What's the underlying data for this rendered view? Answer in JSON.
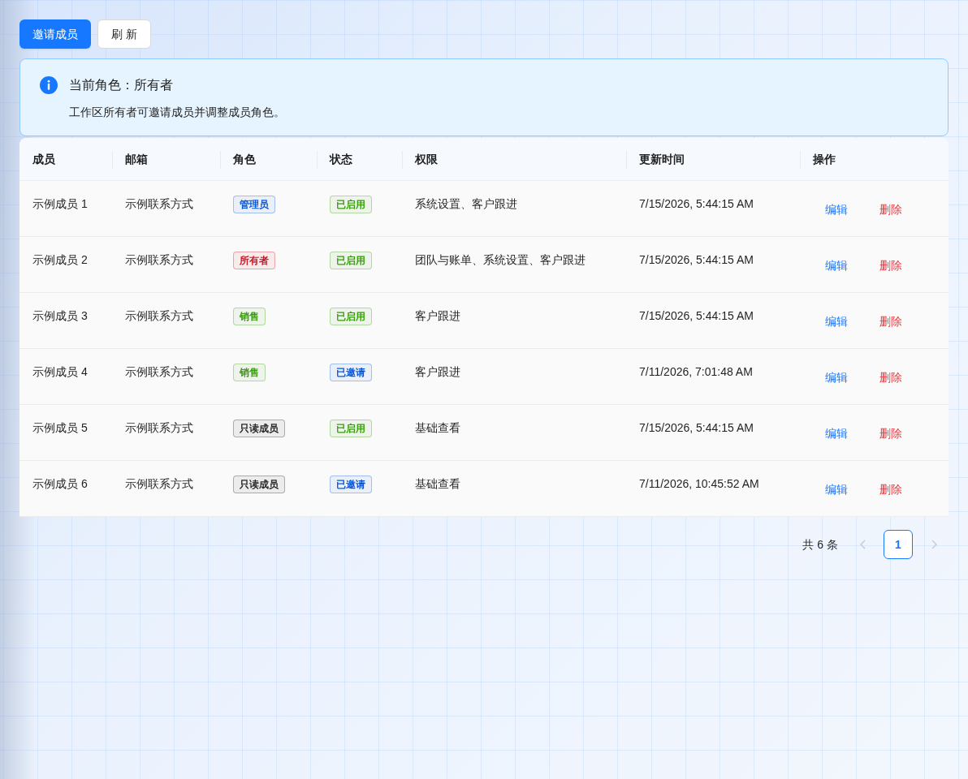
{
  "toolbar": {
    "buttons": [
      {
        "label": "邀请成员",
        "kind": "primary"
      },
      {
        "label": "刷 新",
        "kind": "default"
      }
    ]
  },
  "alert": {
    "title": "当前角色：所有者",
    "description": "工作区所有者可邀请成员并调整成员角色。"
  },
  "table": {
    "columns": [
      "成员",
      "邮箱",
      "角色",
      "状态",
      "权限",
      "更新时间",
      "操作"
    ],
    "rows": [
      {
        "member": "示例成员 1",
        "email": "示例联系方式",
        "role": {
          "label": "管理员",
          "color": "#0958d9"
        },
        "status": {
          "label": "已启用",
          "color": "#389e0d"
        },
        "permissions": "系统设置、客户跟进",
        "updated": "7/15/2026, 5:44:15 AM",
        "actions": [
          {
            "label": "编辑",
            "kind": "edit"
          },
          {
            "label": "删除",
            "kind": "delete"
          }
        ]
      },
      {
        "member": "示例成员 2",
        "email": "示例联系方式",
        "role": {
          "label": "所有者",
          "color": "#cf1322"
        },
        "status": {
          "label": "已启用",
          "color": "#389e0d"
        },
        "permissions": "团队与账单、系统设置、客户跟进",
        "updated": "7/15/2026, 5:44:15 AM",
        "actions": [
          {
            "label": "编辑",
            "kind": "edit"
          },
          {
            "label": "删除",
            "kind": "delete"
          }
        ]
      },
      {
        "member": "示例成员 3",
        "email": "示例联系方式",
        "role": {
          "label": "销售",
          "color": "#389e0d"
        },
        "status": {
          "label": "已启用",
          "color": "#389e0d"
        },
        "permissions": "客户跟进",
        "updated": "7/15/2026, 5:44:15 AM",
        "actions": [
          {
            "label": "编辑",
            "kind": "edit"
          },
          {
            "label": "删除",
            "kind": "delete"
          }
        ]
      },
      {
        "member": "示例成员 4",
        "email": "示例联系方式",
        "role": {
          "label": "销售",
          "color": "#389e0d"
        },
        "status": {
          "label": "已邀请",
          "color": "#0958d9"
        },
        "permissions": "客户跟进",
        "updated": "7/11/2026, 7:01:48 AM",
        "actions": [
          {
            "label": "编辑",
            "kind": "edit"
          },
          {
            "label": "删除",
            "kind": "delete"
          }
        ]
      },
      {
        "member": "示例成员 5",
        "email": "示例联系方式",
        "role": {
          "label": "只读成员",
          "color": "#262626"
        },
        "status": {
          "label": "已启用",
          "color": "#389e0d"
        },
        "permissions": "基础查看",
        "updated": "7/15/2026, 5:44:15 AM",
        "actions": [
          {
            "label": "编辑",
            "kind": "edit"
          },
          {
            "label": "删除",
            "kind": "delete"
          }
        ]
      },
      {
        "member": "示例成员 6",
        "email": "示例联系方式",
        "role": {
          "label": "只读成员",
          "color": "#262626"
        },
        "status": {
          "label": "已邀请",
          "color": "#0958d9"
        },
        "permissions": "基础查看",
        "updated": "7/11/2026, 10:45:52 AM",
        "actions": [
          {
            "label": "编辑",
            "kind": "edit"
          },
          {
            "label": "删除",
            "kind": "delete"
          }
        ]
      }
    ]
  },
  "pagination": {
    "total": "共 6 条",
    "prev": {
      "disabled": true
    },
    "pages": [
      {
        "label": "1",
        "selected": true
      }
    ],
    "next": {
      "disabled": true
    }
  }
}
